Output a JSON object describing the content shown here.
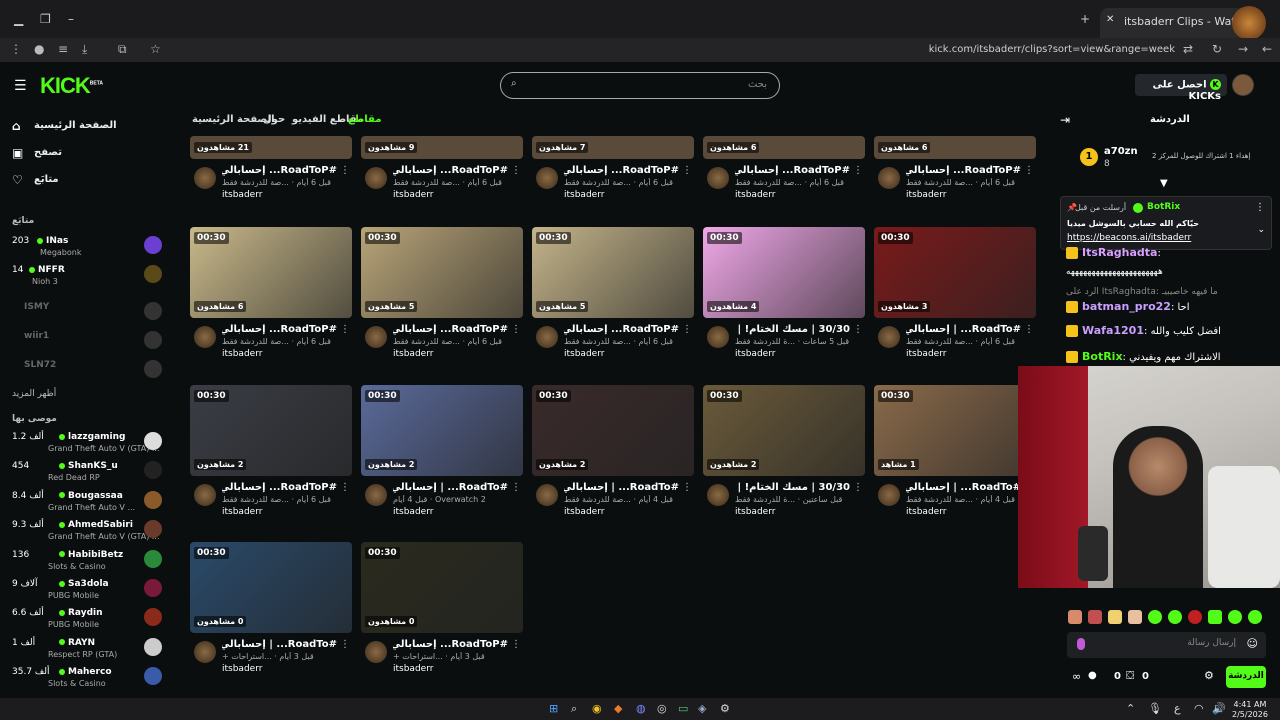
{
  "browser": {
    "tab_title": "itsbaderr Clips - Watch Live on",
    "url": "kick.com/itsbaderr/clips?sort=view&range=week"
  },
  "header": {
    "logo": "KICK",
    "logo_beta": "BETA",
    "search_placeholder": "بحث",
    "kicks_button": "احصل على KICKs"
  },
  "sidebar": {
    "nav": [
      {
        "label": "الصفحة الرئيسية",
        "icon": "home-icon"
      },
      {
        "label": "تصفح",
        "icon": "browse-icon"
      },
      {
        "label": "متابَع",
        "icon": "heart-icon"
      }
    ],
    "following_title": "متابَع",
    "following": [
      {
        "count": "203",
        "name": "INas",
        "category": "Megabonk",
        "color": "#6a3fd1"
      },
      {
        "count": "14",
        "name": "NFFR",
        "category": "Nioh 3",
        "color": "#5a4a1a"
      },
      {
        "count": "",
        "name": "ISMY",
        "category": "",
        "color": "#333"
      },
      {
        "count": "",
        "name": "wiir1",
        "category": "",
        "color": "#333"
      },
      {
        "count": "",
        "name": "SLN72",
        "category": "",
        "color": "#333"
      }
    ],
    "show_more": "أظهر المزيد",
    "recommended_title": "موصى بها",
    "recommended": [
      {
        "count": "1.2 ألف",
        "name": "lazzgaming",
        "category": "Grand Theft Auto V (GTA) ...",
        "color": "#ddd"
      },
      {
        "count": "454",
        "name": "ShanKS_u",
        "category": "Red Dead RP",
        "color": "#222"
      },
      {
        "count": "8.4 ألف",
        "name": "Bougassaa",
        "category": "Grand Theft Auto V ...",
        "color": "#8a5a2a"
      },
      {
        "count": "9.3 ألف",
        "name": "AhmedSabiri",
        "category": "Grand Theft Auto V (GTA) ...",
        "color": "#6a3a2a"
      },
      {
        "count": "136",
        "name": "HabibiBetz",
        "category": "Slots & Casino",
        "color": "#2a8a3a"
      },
      {
        "count": "9 آلاف",
        "name": "Sa3dola",
        "category": "PUBG Mobile",
        "color": "#7a1a3a"
      },
      {
        "count": "6.6 ألف",
        "name": "Raydin",
        "category": "PUBG Mobile",
        "color": "#8a2a1a"
      },
      {
        "count": "1 ألف",
        "name": "RAYN",
        "category": "Respect RP (GTA)",
        "color": "#ccc"
      },
      {
        "count": "35.7 ألف",
        "name": "Maherco",
        "category": "Slots & Casino",
        "color": "#3a5aaa"
      }
    ]
  },
  "content": {
    "tabs": [
      {
        "label": "الصفحة الرئيسية",
        "active": false
      },
      {
        "label": "حول",
        "active": false
      },
      {
        "label": "مقاطع الفيديو",
        "active": false
      },
      {
        "label": "مقاطع",
        "active": true
      }
    ],
    "top_row_views": [
      "21 مشاهدون",
      "9 مشاهدون",
      "7 مشاهدون",
      "6 مشاهدون",
      "6 مشاهدون"
    ],
    "top_row": [
      {
        "title": "#RoadToP... إحسابالي",
        "meta": "قبل 6 أيام · ...صة للدردشة فقط",
        "channel": "itsbaderr"
      },
      {
        "title": "#RoadToP... إحسابالي",
        "meta": "قبل 6 أيام · ...صة للدردشة فقط",
        "channel": "itsbaderr"
      },
      {
        "title": "#RoadToP... إحسابالي",
        "meta": "قبل 6 أيام · ...صة للدردشة فقط",
        "channel": "itsbaderr"
      },
      {
        "title": "#RoadToP... إحسابالي",
        "meta": "قبل 6 أيام · ...صة للدردشة فقط",
        "channel": "itsbaderr"
      },
      {
        "title": "#RoadToP... إحسابالي",
        "meta": "قبل 6 أيام · ...صة للدردشة فقط",
        "channel": "itsbaderr"
      }
    ],
    "clips": [
      {
        "duration": "00:30",
        "views": "6 مشاهدون",
        "title": "#RoadToP... إحسابالي",
        "meta": "قبل 6 أيام · ...صة للدردشة فقط",
        "channel": "itsbaderr",
        "bg": "#c9b98a"
      },
      {
        "duration": "00:30",
        "views": "5 مشاهدون",
        "title": "#RoadToP... إحسابالي",
        "meta": "قبل 6 أيام · ...صة للدردشة فقط",
        "channel": "itsbaderr",
        "bg": "#b8a478"
      },
      {
        "duration": "00:30",
        "views": "5 مشاهدون",
        "title": "#RoadToP... إحسابالي",
        "meta": "قبل 6 أيام · ...صة للدردشة فقط",
        "channel": "itsbaderr",
        "bg": "#c4b48a"
      },
      {
        "duration": "00:30",
        "views": "4 مشاهدون",
        "title": "30/30 | مسك الختام! | ...",
        "meta": "قبل 5 ساعات · ...ة للدردشة فقط",
        "channel": "itsbaderr",
        "bg": "#f0a8e8"
      },
      {
        "duration": "00:30",
        "views": "3 مشاهدون",
        "title": "#RoadTo... | إحسابالي",
        "meta": "قبل 6 أيام · ...صة للدردشة فقط",
        "channel": "itsbaderr",
        "bg": "#7a1a1a"
      },
      {
        "duration": "00:30",
        "views": "2 مشاهدون",
        "title": "#RoadToP... إحسابالي",
        "meta": "قبل 6 أيام · ...صة للدردشة فقط",
        "channel": "itsbaderr",
        "bg": "#3a3d45"
      },
      {
        "duration": "00:30",
        "views": "2 مشاهدون",
        "title": "#RoadTo... | إحسابالي",
        "meta": "Overwatch 2 · قبل 4 أيام",
        "channel": "itsbaderr",
        "bg": "#5a6a9a"
      },
      {
        "duration": "00:30",
        "views": "2 مشاهدون",
        "title": "#RoadTo... | إحسابالي",
        "meta": "قبل 4 أيام · ...صة للدردشة فقط",
        "channel": "itsbaderr",
        "bg": "#3a2a2a"
      },
      {
        "duration": "00:30",
        "views": "2 مشاهدون",
        "title": "30/30 | مسك الختام! | ...",
        "meta": "قبل ساعتين · ...ة للدردشة فقط",
        "channel": "itsbaderr",
        "bg": "#6a5a3a"
      },
      {
        "duration": "00:30",
        "views": "1 مشاهد",
        "title": "#RoadTo... | إحسابالي",
        "meta": "قبل 4 أيام · ...صة للدردشة فقط",
        "channel": "itsbaderr",
        "bg": "#8a6a4a"
      },
      {
        "duration": "00:30",
        "views": "0 مشاهدون",
        "title": "#RoadTo... | إحسابالي",
        "meta": "قبل 3 أيام · ...استراحات +",
        "channel": "itsbaderr",
        "bg": "#2a4a6a"
      },
      {
        "duration": "00:30",
        "views": "0 مشاهدون",
        "title": "#RoadToP... إحسابالي",
        "meta": "قبل 3 أيام · ...استراحات +",
        "channel": "itsbaderr",
        "bg": "#2a2a1e"
      }
    ]
  },
  "chat": {
    "title": "الدردشة",
    "top_gifter_name": "a70zn",
    "top_gifter_count": "8",
    "top_gifter_note": "إهداء 1 اشتراك للوصول للمركز 2",
    "pinned_by": "أرسلت من قبل",
    "pinned_user": "BotRix",
    "pinned_text": "حيّاكم الله حسابي بالسوشل ميديا",
    "pinned_link": "https://beacons.ai/itsbaderr",
    "messages": [
      {
        "user": "ItsRaghadta",
        "text": "",
        "color": "#d8a0ff"
      },
      {
        "user": "",
        "text": "ههههههههههههههههههههههه",
        "color": "#fff"
      },
      {
        "user": "",
        "text": "الرد على ItsRaghadta: ما فيهه خاصيبيـ",
        "color": "#888"
      },
      {
        "user": "batman_pro22",
        "text": "احا",
        "color": "#c9a0ff"
      },
      {
        "user": "Wafa1201",
        "text": "افضل كليب والله",
        "color": "#c9a0ff"
      },
      {
        "user": "BotRix",
        "text": "الاشتراك مهم ويفيدني",
        "color": "#53fc18"
      }
    ],
    "input_placeholder": "إرسال رسالة",
    "send_button": "الدردشة",
    "count_a": "0",
    "count_b": "0"
  },
  "taskbar": {
    "time": "4:41 AM",
    "date": "2/5/2026",
    "lang": "ع"
  }
}
